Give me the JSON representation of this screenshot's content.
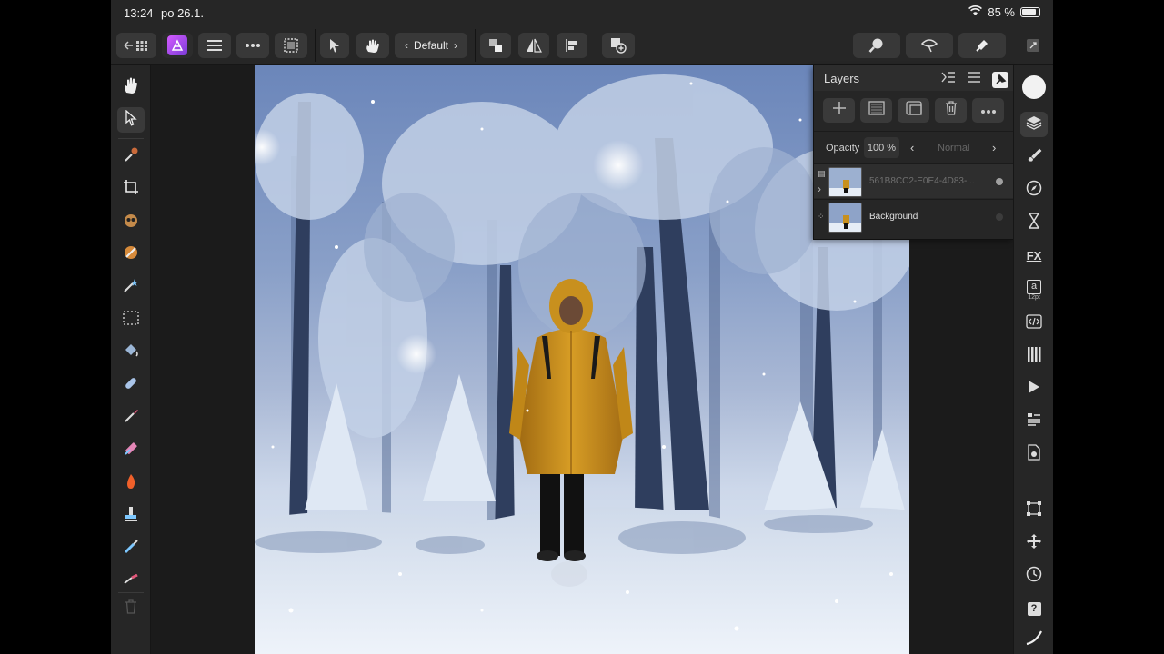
{
  "status_bar": {
    "time": "13:24",
    "date": "po 26.1.",
    "battery": "85 %"
  },
  "toolbar": {
    "back_icon": "back-grid-icon",
    "document_setup_label": "Default",
    "persona": "photo-persona-icon",
    "buttons": [
      "menu-icon",
      "more-icon",
      "selection-icon",
      "move-tool-icon",
      "hand-gesture-icon",
      "arrange-icon",
      "flip-icon",
      "align-icon",
      "add-icon",
      "zoom-icon",
      "assistant-icon",
      "snapping-icon",
      "view-mode-icon"
    ]
  },
  "left_tools": [
    "hand-tool-icon",
    "move-tool-icon",
    "color-picker-icon",
    "crop-icon",
    "red-eye-icon",
    "paint-mixer-icon",
    "magic-wand-icon",
    "marquee-icon",
    "flood-fill-icon",
    "healing-icon",
    "brush-icon",
    "eraser-icon",
    "burn-icon",
    "clone-icon",
    "smudge-icon",
    "smudge-tip-icon",
    "trash-icon"
  ],
  "right_tools": [
    "color-icon",
    "layers-icon",
    "brushes-icon",
    "navigator-icon",
    "history-icon",
    "fx-icon",
    "text-style-icon",
    "code-icon",
    "swatches-icon",
    "macro-icon",
    "styles-icon",
    "settings-doc-icon",
    "transform-icon",
    "move-icon",
    "clock-icon",
    "help-icon",
    "stroke-icon"
  ],
  "text_style_size": "12pt",
  "layers_panel": {
    "title": "Layers",
    "opacity_label": "Opacity",
    "opacity_value": "100 %",
    "blend_mode": "Normal",
    "layers": [
      {
        "name": "561B8CC2-E0E4-4D83-...",
        "visible": true,
        "selected": true,
        "dim": true
      },
      {
        "name": "Background",
        "visible": true,
        "selected": false,
        "dim": false
      }
    ]
  },
  "colors": {
    "accent": "#b357f0",
    "panel": "#262626",
    "jacket": "#c8901e"
  }
}
